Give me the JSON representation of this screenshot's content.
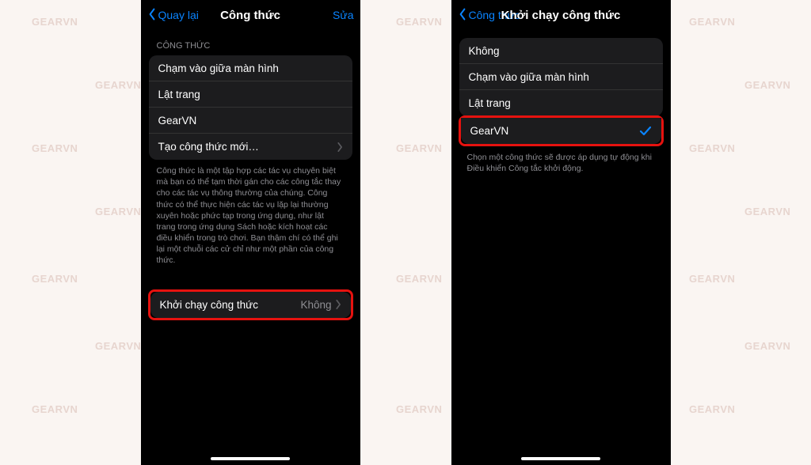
{
  "watermark_text": "GEARVN",
  "left": {
    "nav_back": "Quay lại",
    "nav_title": "Công thức",
    "nav_edit": "Sửa",
    "section_header": "CÔNG THỨC",
    "rows": [
      "Chạm vào giữa màn hình",
      "Lật trang",
      "GearVN",
      "Tạo công thức mới…"
    ],
    "description": "Công thức là một tập hợp các tác vụ chuyên biệt mà bạn có thể tạm thời gán cho các công tắc thay cho các tác vụ thông thường của chúng. Công thức có thể thực hiện các tác vụ lặp lại thường xuyên hoặc phức tạp trong ứng dụng, như lật trang trong ứng dụng Sách hoặc kích hoạt các điều khiển trong trò chơi. Bạn thậm chí có thể ghi lại một chuỗi các cử chỉ như một phần của công thức.",
    "launch_label": "Khởi chạy công thức",
    "launch_value": "Không"
  },
  "right": {
    "nav_back": "Công thức",
    "nav_title": "Khởi chạy công thức",
    "options": [
      "Không",
      "Chạm vào giữa màn hình",
      "Lật trang",
      "GearVN"
    ],
    "footer": "Chọn một công thức sẽ được áp dụng tự động khi Điều khiển Công tắc khởi động."
  }
}
